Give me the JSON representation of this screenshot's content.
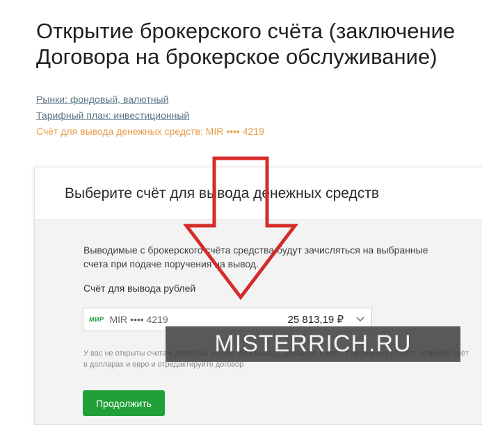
{
  "page": {
    "title": "Открытие брокерского счёта (заключение Договора на брокерское обслуживание)"
  },
  "summary": {
    "markets": "Рынки: фондовый, валютный",
    "tariff": "Тарифный план: инвестиционный",
    "withdraw": "Счёт для вывода денежных средств: MIR •••• 4219"
  },
  "card": {
    "title": "Выберите счёт для вывода денежных средств",
    "description": "Выводимые с брокерского счёта средства будут зачисляться на выбранные счета при подаче поручения на вывод.",
    "field_label": "Счёт для вывода рублей",
    "select": {
      "logo": "МИР",
      "account": "MIR •••• 4219",
      "balance": "25 813,19 ₽"
    },
    "note": "У вас не открыты счета в долларах и евро. Для вывода долларов и евро с брокерского счёта, откройте счёт в долларах и евро и отредактируйте договор",
    "continue_label": "Продолжить"
  },
  "watermark": {
    "text": "MISTERRICH.RU"
  },
  "colors": {
    "accent_green": "#21a038",
    "link": "#5d7787",
    "active_link": "#e89b49",
    "arrow": "#d62b2b"
  },
  "icons": {
    "select_chevron": "chevron-down-icon",
    "annotation": "red-arrow-down"
  }
}
